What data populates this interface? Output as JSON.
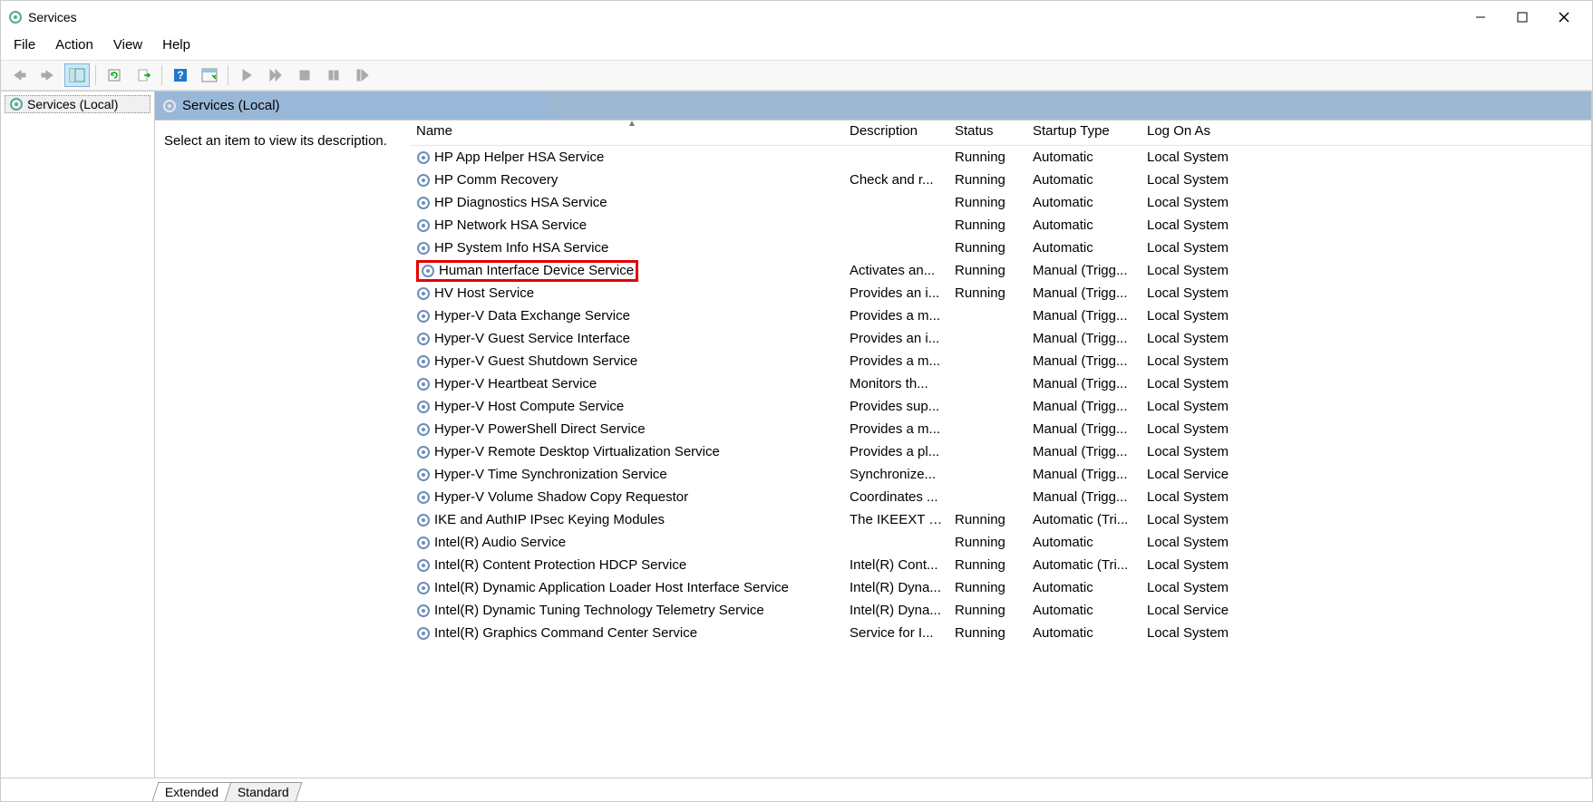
{
  "window": {
    "title": "Services"
  },
  "menu": {
    "file": "File",
    "action": "Action",
    "view": "View",
    "help": "Help"
  },
  "tree": {
    "root": "Services (Local)"
  },
  "header": {
    "title": "Services (Local)"
  },
  "desc_pane": {
    "prompt": "Select an item to view its description."
  },
  "columns": {
    "name": "Name",
    "description": "Description",
    "status": "Status",
    "startup": "Startup Type",
    "logon": "Log On As"
  },
  "tabs": {
    "extended": "Extended",
    "standard": "Standard"
  },
  "highlight_index": 5,
  "services": [
    {
      "name": "HP App Helper HSA Service",
      "description": "",
      "status": "Running",
      "startup": "Automatic",
      "logon": "Local System"
    },
    {
      "name": "HP Comm Recovery",
      "description": "Check and r...",
      "status": "Running",
      "startup": "Automatic",
      "logon": "Local System"
    },
    {
      "name": "HP Diagnostics HSA Service",
      "description": "",
      "status": "Running",
      "startup": "Automatic",
      "logon": "Local System"
    },
    {
      "name": "HP Network HSA Service",
      "description": "",
      "status": "Running",
      "startup": "Automatic",
      "logon": "Local System"
    },
    {
      "name": "HP System Info HSA Service",
      "description": "",
      "status": "Running",
      "startup": "Automatic",
      "logon": "Local System"
    },
    {
      "name": "Human Interface Device Service",
      "description": "Activates an...",
      "status": "Running",
      "startup": "Manual (Trigg...",
      "logon": "Local System"
    },
    {
      "name": "HV Host Service",
      "description": "Provides an i...",
      "status": "Running",
      "startup": "Manual (Trigg...",
      "logon": "Local System"
    },
    {
      "name": "Hyper-V Data Exchange Service",
      "description": "Provides a m...",
      "status": "",
      "startup": "Manual (Trigg...",
      "logon": "Local System"
    },
    {
      "name": "Hyper-V Guest Service Interface",
      "description": "Provides an i...",
      "status": "",
      "startup": "Manual (Trigg...",
      "logon": "Local System"
    },
    {
      "name": "Hyper-V Guest Shutdown Service",
      "description": "Provides a m...",
      "status": "",
      "startup": "Manual (Trigg...",
      "logon": "Local System"
    },
    {
      "name": "Hyper-V Heartbeat Service",
      "description": "Monitors th...",
      "status": "",
      "startup": "Manual (Trigg...",
      "logon": "Local System"
    },
    {
      "name": "Hyper-V Host Compute Service",
      "description": "Provides sup...",
      "status": "",
      "startup": "Manual (Trigg...",
      "logon": "Local System"
    },
    {
      "name": "Hyper-V PowerShell Direct Service",
      "description": "Provides a m...",
      "status": "",
      "startup": "Manual (Trigg...",
      "logon": "Local System"
    },
    {
      "name": "Hyper-V Remote Desktop Virtualization Service",
      "description": "Provides a pl...",
      "status": "",
      "startup": "Manual (Trigg...",
      "logon": "Local System"
    },
    {
      "name": "Hyper-V Time Synchronization Service",
      "description": "Synchronize...",
      "status": "",
      "startup": "Manual (Trigg...",
      "logon": "Local Service"
    },
    {
      "name": "Hyper-V Volume Shadow Copy Requestor",
      "description": "Coordinates ...",
      "status": "",
      "startup": "Manual (Trigg...",
      "logon": "Local System"
    },
    {
      "name": "IKE and AuthIP IPsec Keying Modules",
      "description": "The IKEEXT s...",
      "status": "Running",
      "startup": "Automatic (Tri...",
      "logon": "Local System"
    },
    {
      "name": "Intel(R) Audio Service",
      "description": "",
      "status": "Running",
      "startup": "Automatic",
      "logon": "Local System"
    },
    {
      "name": "Intel(R) Content Protection HDCP Service",
      "description": "Intel(R) Cont...",
      "status": "Running",
      "startup": "Automatic (Tri...",
      "logon": "Local System"
    },
    {
      "name": "Intel(R) Dynamic Application Loader Host Interface Service",
      "description": "Intel(R) Dyna...",
      "status": "Running",
      "startup": "Automatic",
      "logon": "Local System"
    },
    {
      "name": "Intel(R) Dynamic Tuning Technology Telemetry Service",
      "description": "Intel(R) Dyna...",
      "status": "Running",
      "startup": "Automatic",
      "logon": "Local Service"
    },
    {
      "name": "Intel(R) Graphics Command Center Service",
      "description": "Service for I...",
      "status": "Running",
      "startup": "Automatic",
      "logon": "Local System"
    }
  ]
}
